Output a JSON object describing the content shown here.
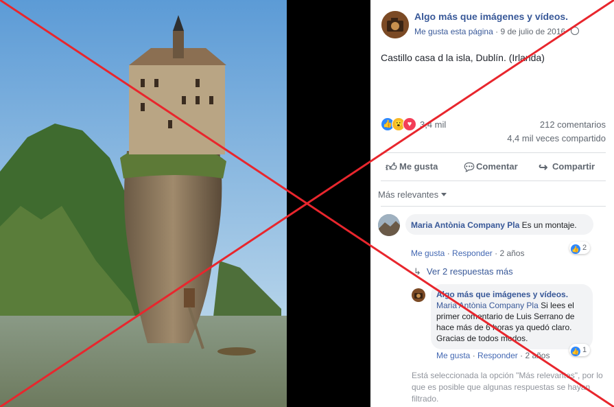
{
  "post": {
    "page_name": "Algo más que imágenes y vídeos.",
    "page_like": "Me gusta esta página",
    "separator": "·",
    "date": "9 de julio de 2016",
    "text": "Castillo casa d la isla, Dublín. (Irlanda)",
    "reaction_count": "3,4 mil",
    "comments_count": "212 comentarios",
    "shares_count": "4,4 mil veces compartido"
  },
  "actions": {
    "like": "Me gusta",
    "comment": "Comentar",
    "share": "Compartir"
  },
  "filter": {
    "label": "Más relevantes"
  },
  "comments": [
    {
      "author": "Maria Antònia Company Pla",
      "text": "Es un montaje.",
      "like": "Me gusta",
      "reply": "Responder",
      "time": "2 años",
      "sep": "·",
      "reactions": "2"
    }
  ],
  "more_replies": "Ver 2 respuestas más",
  "reply": {
    "author": "Algo más que imágenes y vídeos.",
    "mention": "Maria Antònia Company Pla",
    "text": "Si lees el primer comentario de Luis Serrano de hace más de 6 horas ya quedó claro. Gracias de todos modos.",
    "like": "Me gusta",
    "reply": "Responder",
    "time": "2 años",
    "sep": "·",
    "reactions": "1"
  },
  "filter_note": "Está seleccionada la opción \"Más relevantes\", por lo que es posible que algunas respuestas se hayan filtrado.",
  "colors": {
    "link": "#385898",
    "cross": "#e8262d",
    "like_blue": "#2d88ff"
  },
  "icons": [
    "globe-icon",
    "like-reaction-icon",
    "wow-reaction-icon",
    "love-reaction-icon",
    "thumb-icon",
    "comment-icon",
    "share-icon",
    "reply-arrow-icon"
  ]
}
